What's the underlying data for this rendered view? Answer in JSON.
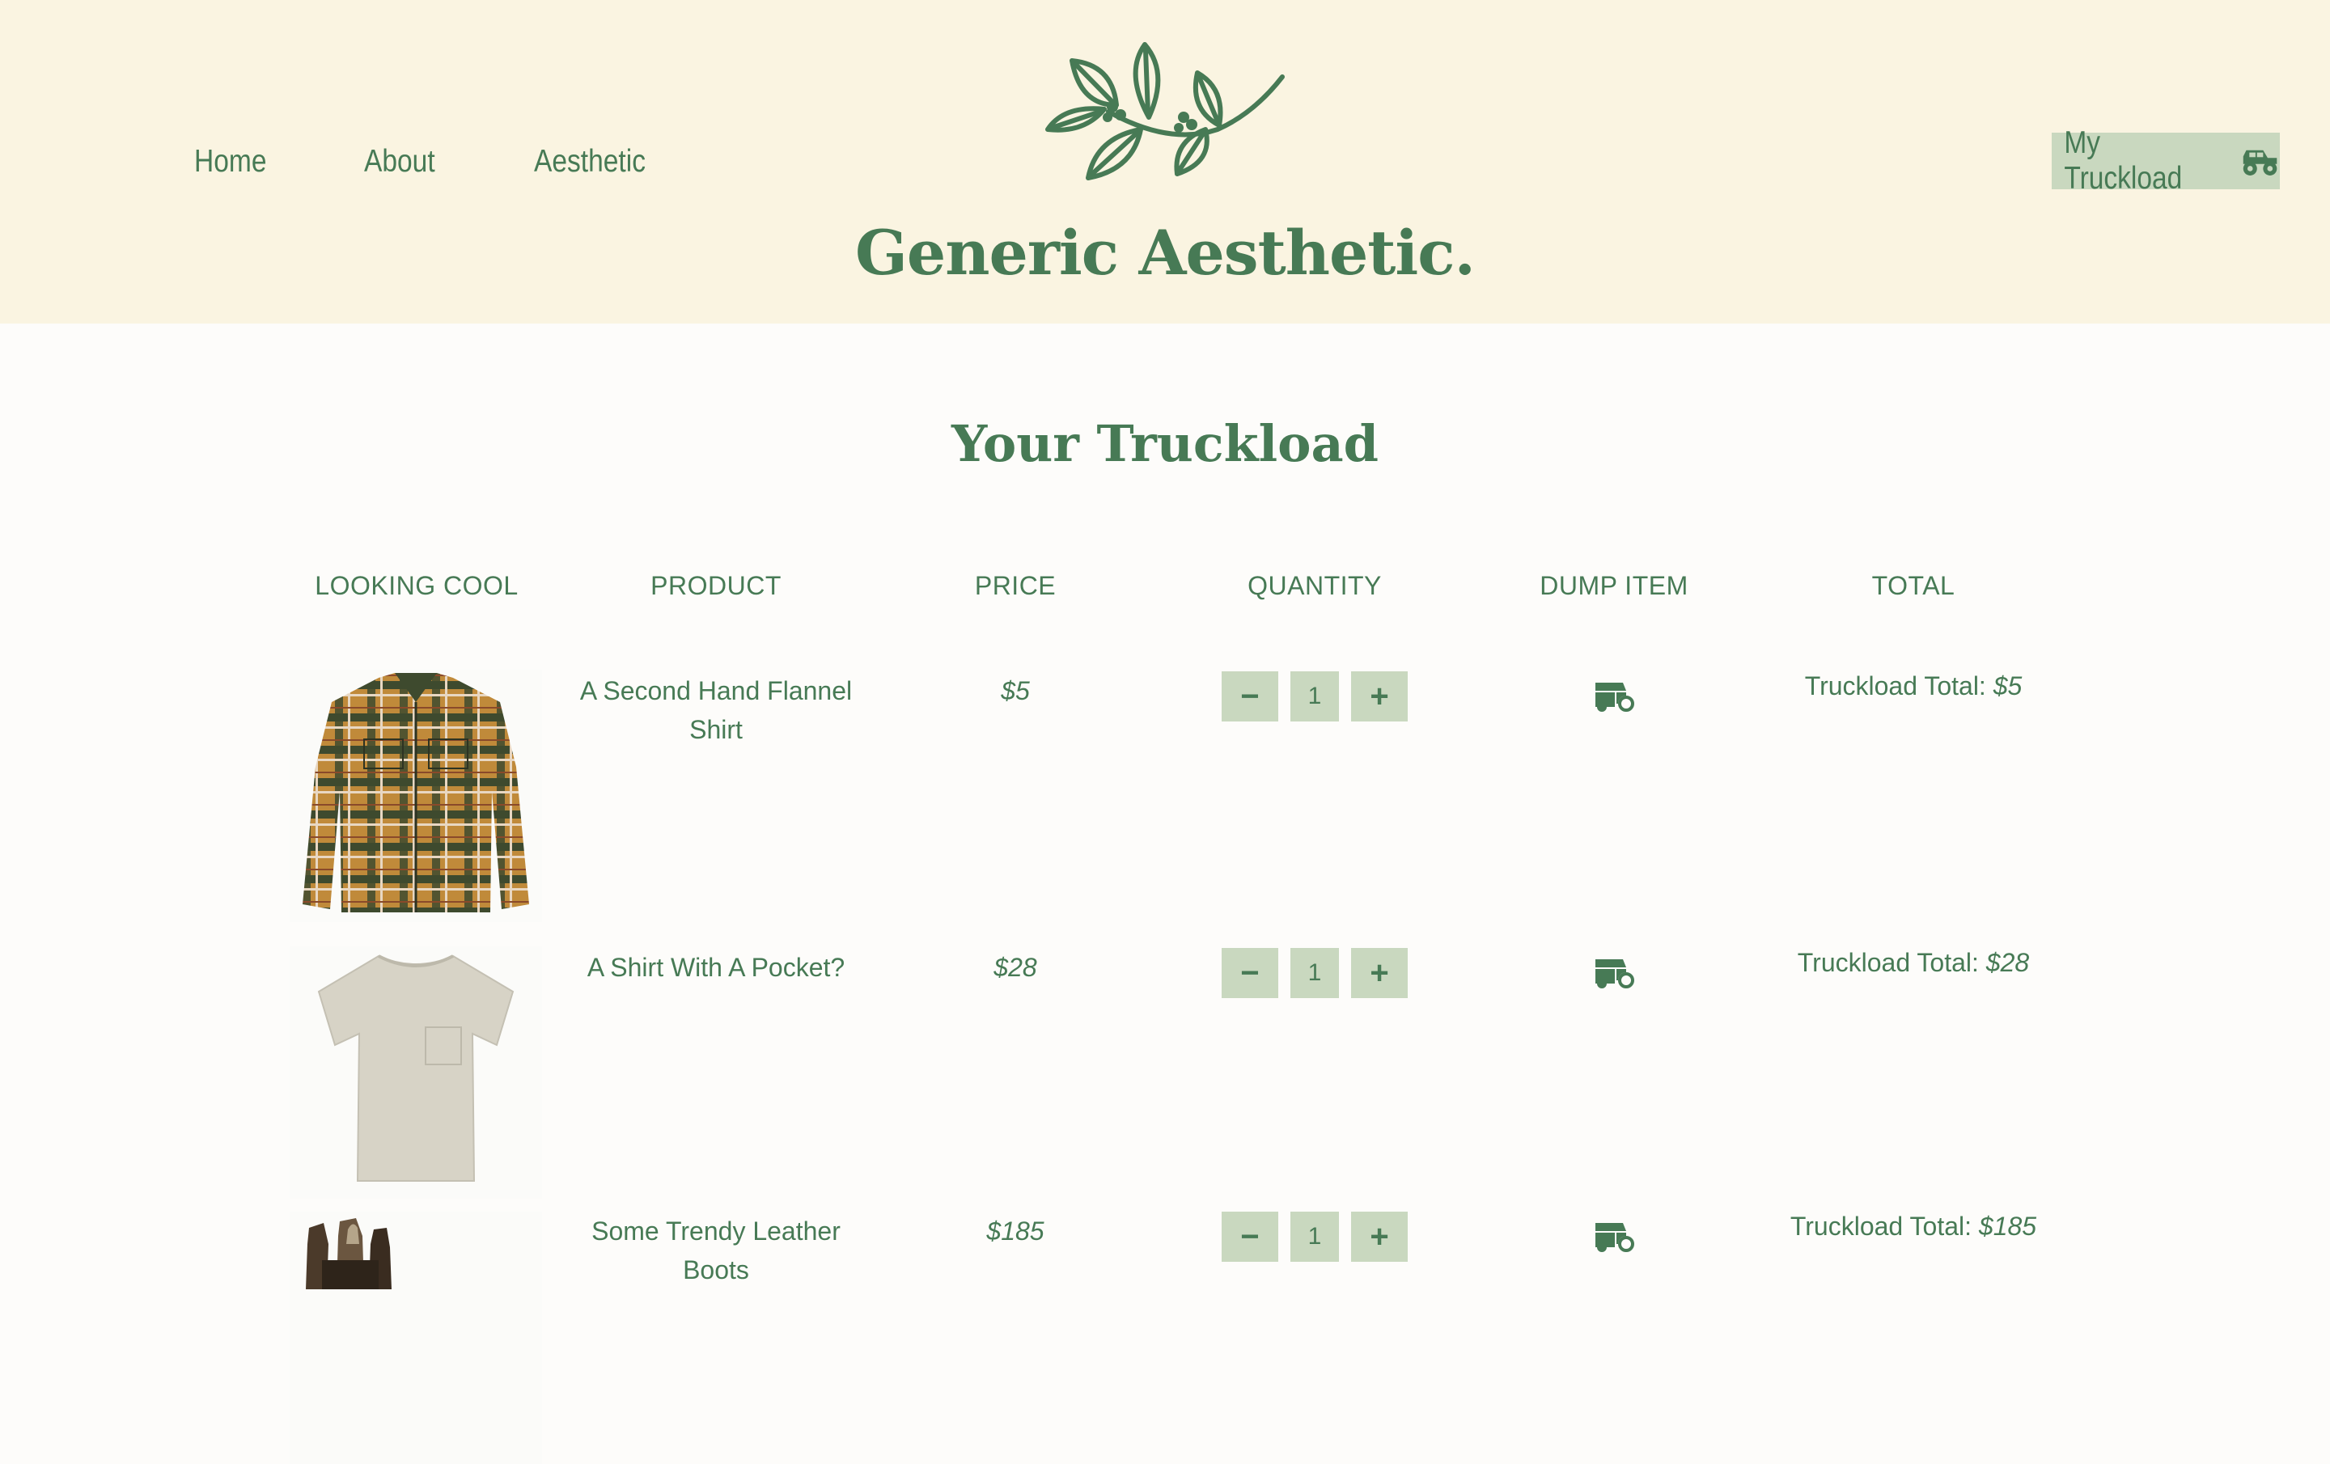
{
  "header": {
    "nav": [
      {
        "label": "Home"
      },
      {
        "label": "About"
      },
      {
        "label": "Aesthetic"
      }
    ],
    "brand": "Generic Aesthetic.",
    "cart_button": {
      "label": "My Truckload",
      "icon": "monster-truck-icon"
    },
    "logo_icon": "leaf-branch-icon"
  },
  "cart": {
    "title": "Your Truckload",
    "columns": [
      "LOOKING COOL",
      "PRODUCT",
      "PRICE",
      "QUANTITY",
      "DUMP ITEM",
      "TOTAL"
    ],
    "total_label": "Truckload Total:",
    "rows": [
      {
        "product_line1": "A Second Hand Flannel",
        "product_line2": "Shirt",
        "price": "$5",
        "quantity": "1",
        "total": "$5",
        "image": "plaid-flannel-shirt"
      },
      {
        "product_line1": "A Shirt With A Pocket?",
        "product_line2": "",
        "price": "$28",
        "quantity": "1",
        "total": "$28",
        "image": "beige-pocket-tshirt"
      },
      {
        "product_line1": "Some Trendy Leather",
        "product_line2": "Boots",
        "price": "$185",
        "quantity": "1",
        "total": "$185",
        "image": "leather-boots"
      }
    ]
  },
  "colors": {
    "accent": "#477a55",
    "header_bg": "#faf4e1",
    "button_bg": "#c9d8bf",
    "page_bg": "#fdfcfa"
  }
}
